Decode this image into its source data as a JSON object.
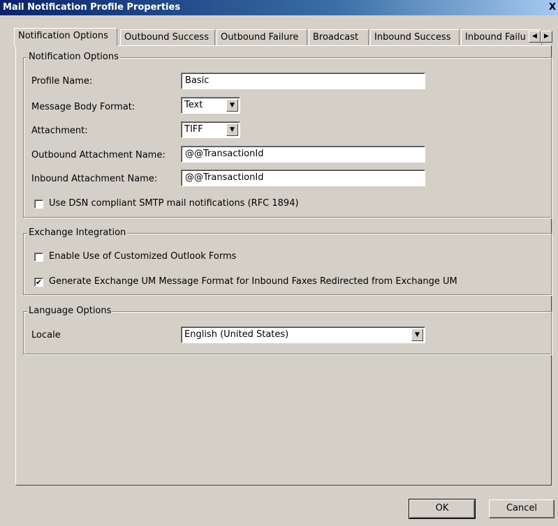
{
  "window": {
    "title": "Mail Notification Profile Properties",
    "close_glyph": "X"
  },
  "tabs": [
    {
      "label": "Notification Options",
      "active": true
    },
    {
      "label": "Outbound Success",
      "active": false
    },
    {
      "label": "Outbound Failure",
      "active": false
    },
    {
      "label": "Broadcast",
      "active": false
    },
    {
      "label": "Inbound Success",
      "active": false
    },
    {
      "label": "Inbound Failu",
      "active": false
    }
  ],
  "tab_scroll": {
    "left_glyph": "◀",
    "right_glyph": "▶"
  },
  "notification_options": {
    "legend": "Notification Options",
    "profile_name_label": "Profile Name:",
    "profile_name_value": "Basic",
    "message_body_format_label": "Message Body Format:",
    "message_body_format_value": "Text",
    "attachment_label": "Attachment:",
    "attachment_value": "TIFF",
    "outbound_attachment_name_label": "Outbound Attachment Name:",
    "outbound_attachment_name_value": "@@TransactionId",
    "inbound_attachment_name_label": "Inbound Attachment Name:",
    "inbound_attachment_name_value": "@@TransactionId",
    "dsn_label": "Use DSN compliant SMTP mail notifications (RFC 1894)",
    "dsn_checked": false
  },
  "exchange_integration": {
    "legend": "Exchange Integration",
    "outlook_forms_label": "Enable Use of Customized Outlook Forms",
    "outlook_forms_checked": false,
    "um_format_label": "Generate Exchange UM Message Format for Inbound Faxes Redirected from Exchange UM",
    "um_format_checked": true
  },
  "language_options": {
    "legend": "Language Options",
    "locale_label": "Locale",
    "locale_value": "English (United States)"
  },
  "buttons": {
    "ok": "OK",
    "cancel": "Cancel"
  },
  "glyphs": {
    "dropdown_arrow": "▼",
    "checkmark": "✔"
  }
}
